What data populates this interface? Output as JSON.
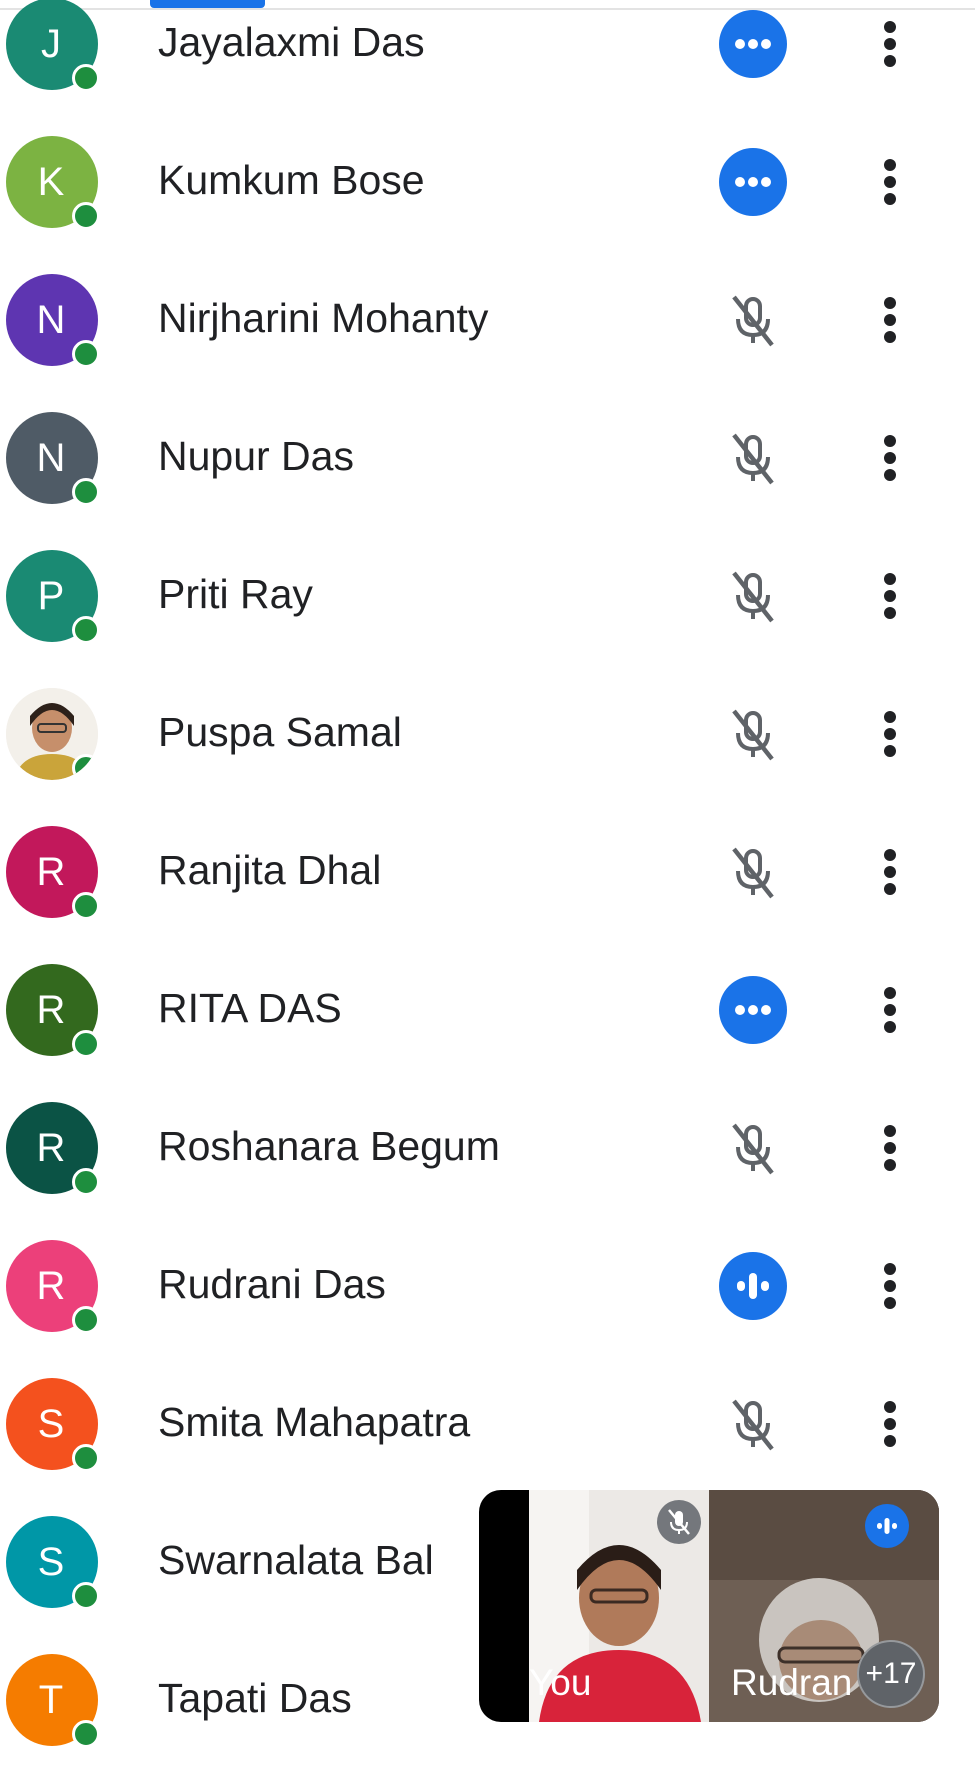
{
  "participants": [
    {
      "initial": "J",
      "name": "Jayalaxmi Das",
      "color": "#1a8a73",
      "status": "dots-icon"
    },
    {
      "initial": "K",
      "name": "Kumkum Bose",
      "color": "#7cb342",
      "status": "dots-icon"
    },
    {
      "initial": "N",
      "name": "Nirjharini Mohanty",
      "color": "#5e35b1",
      "status": "mic-off-icon"
    },
    {
      "initial": "N",
      "name": "Nupur Das",
      "color": "#4f5b66",
      "status": "mic-off-icon"
    },
    {
      "initial": "P",
      "name": "Priti Ray",
      "color": "#1a8a73",
      "status": "mic-off-icon"
    },
    {
      "initial": "",
      "name": "Puspa Samal",
      "color": "#f1eee8",
      "status": "mic-off-icon",
      "photo": true
    },
    {
      "initial": "R",
      "name": "Ranjita Dhal",
      "color": "#c2185b",
      "status": "mic-off-icon"
    },
    {
      "initial": "R",
      "name": "RITA DAS",
      "color": "#33691e",
      "status": "dots-icon"
    },
    {
      "initial": "R",
      "name": "Roshanara Begum",
      "color": "#0b5345",
      "status": "mic-off-icon"
    },
    {
      "initial": "R",
      "name": "Rudrani Das",
      "color": "#ec407a",
      "status": "speaking-icon"
    },
    {
      "initial": "S",
      "name": "Smita Mahapatra",
      "color": "#f4511e",
      "status": "mic-off-icon"
    },
    {
      "initial": "S",
      "name": "Swarnalata Bal",
      "color": "#0097a7",
      "status": "none"
    },
    {
      "initial": "T",
      "name": "Tapati Das",
      "color": "#f57c00",
      "status": "none"
    }
  ],
  "pip": {
    "you_label": "You",
    "other_label": "Rudran",
    "more_count": "+17"
  },
  "colors": {
    "accent": "#1a73e8",
    "presence": "#1e8e3e",
    "icon_gray": "#5f6368"
  }
}
